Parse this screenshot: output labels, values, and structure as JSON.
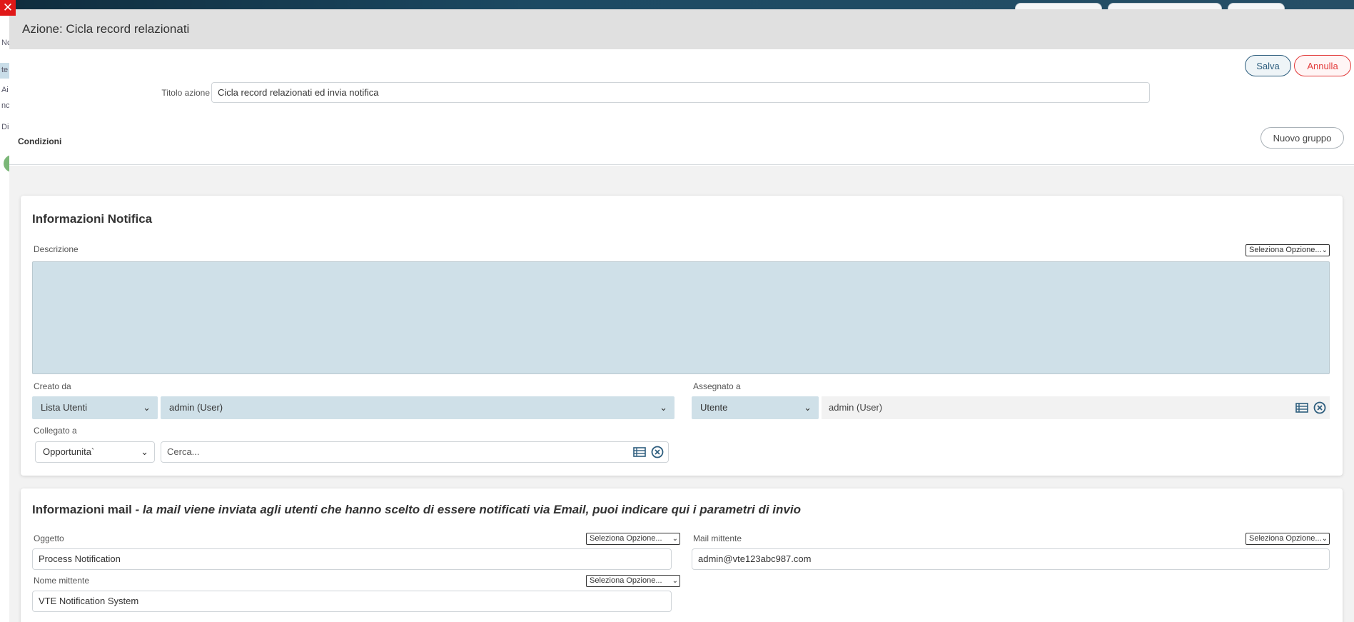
{
  "background": {
    "fragments": [
      "Nc",
      "te",
      "Ai",
      "nc",
      "Di"
    ]
  },
  "modal": {
    "title": "Azione: Cicla record relazionati",
    "close_icon": "close-icon",
    "save_label": "Salva",
    "cancel_label": "Annulla"
  },
  "action": {
    "title_label": "Titolo azione",
    "title_value": "Cicla record relazionati ed invia notifica"
  },
  "conditions": {
    "label": "Condizioni",
    "new_group_label": "Nuovo gruppo"
  },
  "notification": {
    "section_title": "Informazioni Notifica",
    "description_label": "Descrizione",
    "description_select": "Seleziona Opzione...",
    "description_value": "",
    "created_by": {
      "label": "Creato da",
      "type": "Lista Utenti",
      "value": "admin (User)"
    },
    "assigned_to": {
      "label": "Assegnato a",
      "type": "Utente",
      "value": "admin (User)"
    },
    "linked_to": {
      "label": "Collegato a",
      "module": "Opportunita`",
      "search_placeholder": "Cerca..."
    }
  },
  "mail": {
    "section_title": "Informazioni mail",
    "section_note": "- la mail viene inviata agli utenti che hanno scelto di essere notificati via Email, puoi indicare qui i parametri di invio",
    "subject_label": "Oggetto",
    "subject_select": "Seleziona Opzione...",
    "subject_value": "Process Notification",
    "sender_mail_label": "Mail mittente",
    "sender_mail_select": "Seleziona Opzione...",
    "sender_mail_value": "admin@vte123abc987.com",
    "sender_name_label": "Nome mittente",
    "sender_name_select": "Seleziona Opzione...",
    "sender_name_value": "VTE Notification System"
  },
  "colors": {
    "accent": "#2e5e7e",
    "danger": "#e23b3b",
    "field_bg": "#cfe0e8",
    "close_red": "#e01818"
  }
}
